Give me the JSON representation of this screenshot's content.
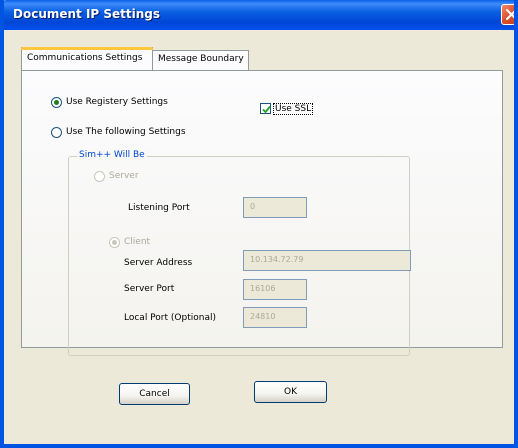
{
  "window": {
    "title": "Document IP Settings"
  },
  "tabs": [
    {
      "label": "Communications Settings"
    },
    {
      "label": "Message Boundary"
    }
  ],
  "settings": {
    "registry_label": "Use Registery Settings",
    "following_label": "Use The following Settings",
    "ssl_label": "Use SSL",
    "ssl_checked": true,
    "registry_selected": true
  },
  "group": {
    "title": "Sim++ Will Be",
    "server_label": "Server",
    "listening_port_label": "Listening Port",
    "listening_port_value": "0",
    "client_label": "Client",
    "server_address_label": "Server Address",
    "server_address_value": "10.134.72.79",
    "server_port_label": "Server Port",
    "server_port_value": "16106",
    "local_port_label": "Local Port (Optional)",
    "local_port_value": "24810"
  },
  "buttons": {
    "cancel": "Cancel",
    "ok": "OK"
  },
  "colors": {
    "title_bar": "#0054e3",
    "tab_highlight": "#ffc83c",
    "group_title": "#0046d5",
    "disabled_text": "#aca899",
    "close": "#e0502d"
  },
  "icons": {
    "close": "close-icon",
    "check": "check-icon"
  }
}
